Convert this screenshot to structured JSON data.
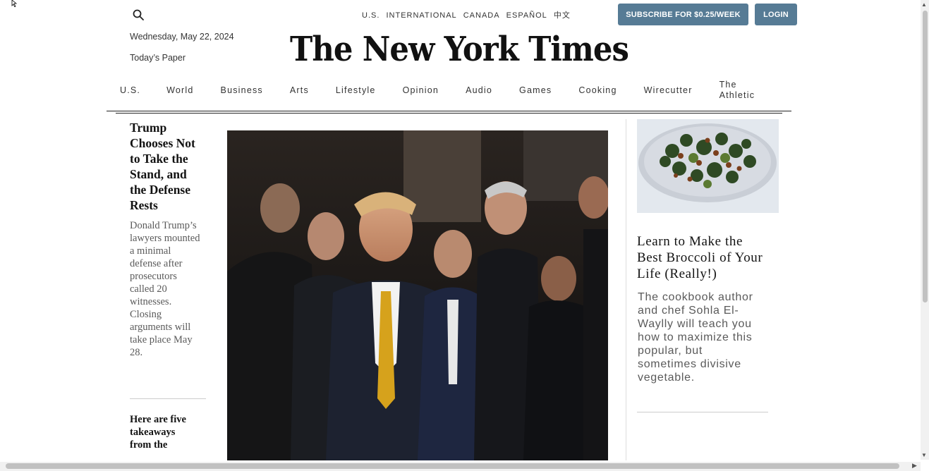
{
  "header": {
    "search_icon": "search-icon",
    "editions": [
      "U.S.",
      "INTERNATIONAL",
      "CANADA",
      "ESPAÑOL",
      "中文"
    ],
    "subscribe_label": "SUBSCRIBE FOR $0.25/WEEK",
    "login_label": "LOGIN",
    "date": "Wednesday, May 22, 2024",
    "todays_paper": "Today’s Paper",
    "logo_text": "The New York Times"
  },
  "nav": {
    "items": [
      "U.S.",
      "World",
      "Business",
      "Arts",
      "Lifestyle",
      "Opinion",
      "Audio",
      "Games",
      "Cooking",
      "Wirecutter",
      "The Athletic"
    ]
  },
  "lead_story": {
    "headline": "Trump Chooses Not to Take the Stand, and the Defense Rests",
    "summary": "Donald Trump’s lawyers mounted a minimal defense after prosecutors called 20 witnesses. Closing arguments will take place May 28."
  },
  "second_story": {
    "headline": "Here are five takeaways from the"
  },
  "cooking_story": {
    "headline": "Learn to Make the Best Broccoli of Your Life (Really!)",
    "summary": "The cookbook author and chef Sohla El-Waylly will teach you how to maximize this popular, but sometimes divisive vegetable."
  },
  "colors": {
    "button_bg": "#567b95",
    "text": "#121212",
    "summary_text": "#5a5a5a"
  }
}
